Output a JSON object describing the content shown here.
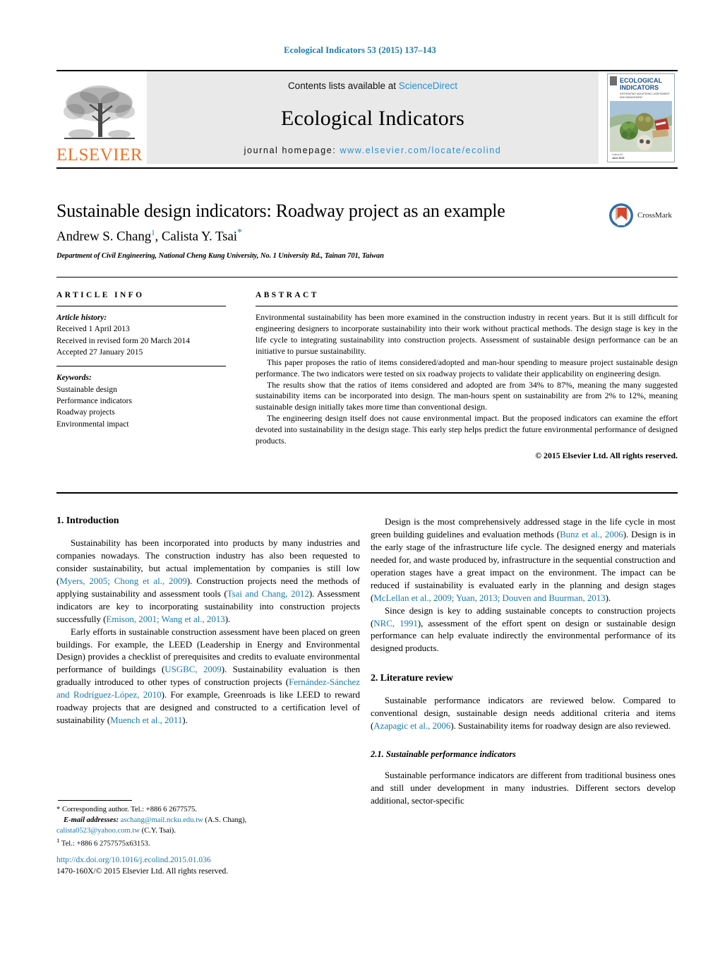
{
  "running_head": "Ecological Indicators 53 (2015) 137–143",
  "masthead": {
    "publisher": "ELSEVIER",
    "contents_prefix": "Contents lists available at ",
    "contents_link": "ScienceDirect",
    "journal_name": "Ecological Indicators",
    "homepage_prefix": "journal homepage: ",
    "homepage_url": "www.elsevier.com/locate/ecolind",
    "cover_title_line1": "ECOLOGICAL",
    "cover_title_line2": "INDICATORS",
    "cover_subtitle": "INTEGRATING MONITORING, ASSESSMENT AND MANAGEMENT",
    "accent_color": "#2b8fcb",
    "elsevier_orange": "#F37021",
    "band_background": "#e9e9e9"
  },
  "title": "Sustainable design indicators: Roadway project as an example",
  "authors": {
    "author1": "Andrew S. Chang",
    "author1_marker": "1",
    "separator": ", ",
    "author2": "Calista Y. Tsai",
    "author2_marker": "*"
  },
  "affiliation": "Department of Civil Engineering, National Cheng Kung University, No. 1 University Rd., Tainan 701, Taiwan",
  "crossmark": {
    "label": "CrossMark"
  },
  "article_info": {
    "heading": "ARTICLE INFO",
    "history_label": "Article history:",
    "history": [
      "Received 1 April 2013",
      "Received in revised form 20 March 2014",
      "Accepted 27 January 2015"
    ],
    "keywords_label": "Keywords:",
    "keywords": [
      "Sustainable design",
      "Performance indicators",
      "Roadway projects",
      "Environmental impact"
    ]
  },
  "abstract": {
    "heading": "ABSTRACT",
    "paragraphs": [
      "Environmental sustainability has been more examined in the construction industry in recent years. But it is still difficult for engineering designers to incorporate sustainability into their work without practical methods. The design stage is key in the life cycle to integrating sustainability into construction projects. Assessment of sustainable design performance can be an initiative to pursue sustainability.",
      "This paper proposes the ratio of items considered/adopted and man-hour spending to measure project sustainable design performance. The two indicators were tested on six roadway projects to validate their applicability on engineering design.",
      "The results show that the ratios of items considered and adopted are from 34% to 87%, meaning the many suggested sustainability items can be incorporated into design. The man-hours spent on sustainability are from 2% to 12%, meaning sustainable design initially takes more time than conventional design.",
      "The engineering design itself does not cause environmental impact. But the proposed indicators can examine the effort devoted into sustainability in the design stage. This early step helps predict the future environmental performance of designed products."
    ],
    "copyright": "© 2015 Elsevier Ltd. All rights reserved."
  },
  "body": {
    "left": {
      "section1_heading": "1.  Introduction",
      "p1_a": "Sustainability has been incorporated into products by many industries and companies nowadays. The construction industry has also been requested to consider sustainability, but actual implementation by companies is still low (",
      "p1_cite1": "Myers, 2005; Chong et al., 2009",
      "p1_b": "). Construction projects need the methods of applying sustainability and assessment tools (",
      "p1_cite2": "Tsai and Chang, 2012",
      "p1_c": "). Assessment indicators are key to incorporating sustainability into construction projects successfully (",
      "p1_cite3": "Emison, 2001; Wang et al., 2013",
      "p1_d": ").",
      "p2_a": "Early efforts in sustainable construction assessment have been placed on green buildings. For example, the LEED (Leadership in Energy and Environmental Design) provides a checklist of prerequisites and credits to evaluate environmental performance of buildings (",
      "p2_cite1": "USGBC, 2009",
      "p2_b": "). Sustainability evaluation is then gradually introduced to other types of construction projects (",
      "p2_cite2": "Fernández-Sánchez and Rodríguez-López, 2010",
      "p2_c": "). For example, Greenroads is like LEED to reward roadway projects that are designed and constructed to a certification level of sustainability (",
      "p2_cite3": "Muench et al., 2011",
      "p2_d": ")."
    },
    "right": {
      "p1_a": "Design is the most comprehensively addressed stage in the life cycle in most green building guidelines and evaluation methods (",
      "p1_cite1": "Bunz et al., 2006",
      "p1_b": "). Design is in the early stage of the infrastructure life cycle. The designed energy and materials needed for, and waste produced by, infrastructure in the sequential construction and operation stages have a great impact on the environment. The impact can be reduced if sustainability is evaluated early in the planning and design stages (",
      "p1_cite2": "McLellan et al., 2009; Yuan, 2013; Douven and Buurman, 2013",
      "p1_c": ").",
      "p2_a": "Since design is key to adding sustainable concepts to construction projects (",
      "p2_cite1": "NRC, 1991",
      "p2_b": "), assessment of the effort spent on design or sustainable design performance can help evaluate indirectly the environmental performance of its designed products.",
      "section2_heading": "2.  Literature review",
      "p3_a": "Sustainable performance indicators are reviewed below. Compared to conventional design, sustainable design needs additional criteria and items (",
      "p3_cite1": "Azapagic et al., 2006",
      "p3_b": "). Sustainability items for roadway design are also reviewed.",
      "subsection21_heading": "2.1.  Sustainable performance indicators",
      "p4": "Sustainable performance indicators are different from traditional business ones and still under development in many industries. Different sectors develop additional, sector-specific"
    }
  },
  "footnotes": {
    "corresponding_marker": "*",
    "corresponding": " Corresponding author. Tel.: +886 6 2677575.",
    "email_label": "E-mail addresses:",
    "email1": "aschang@mail.ncku.edu.tw",
    "email1_owner": " (A.S. Chang),",
    "email2": "calista0523@yahoo.com.tw",
    "email2_owner": " (C.Y. Tsai).",
    "fn1_marker": "1",
    "fn1": " Tel.: +886 6 2757575x63153."
  },
  "doi": {
    "url": "http://dx.doi.org/10.1016/j.ecolind.2015.01.036",
    "issn_line": "1470-160X/© 2015 Elsevier Ltd. All rights reserved."
  }
}
